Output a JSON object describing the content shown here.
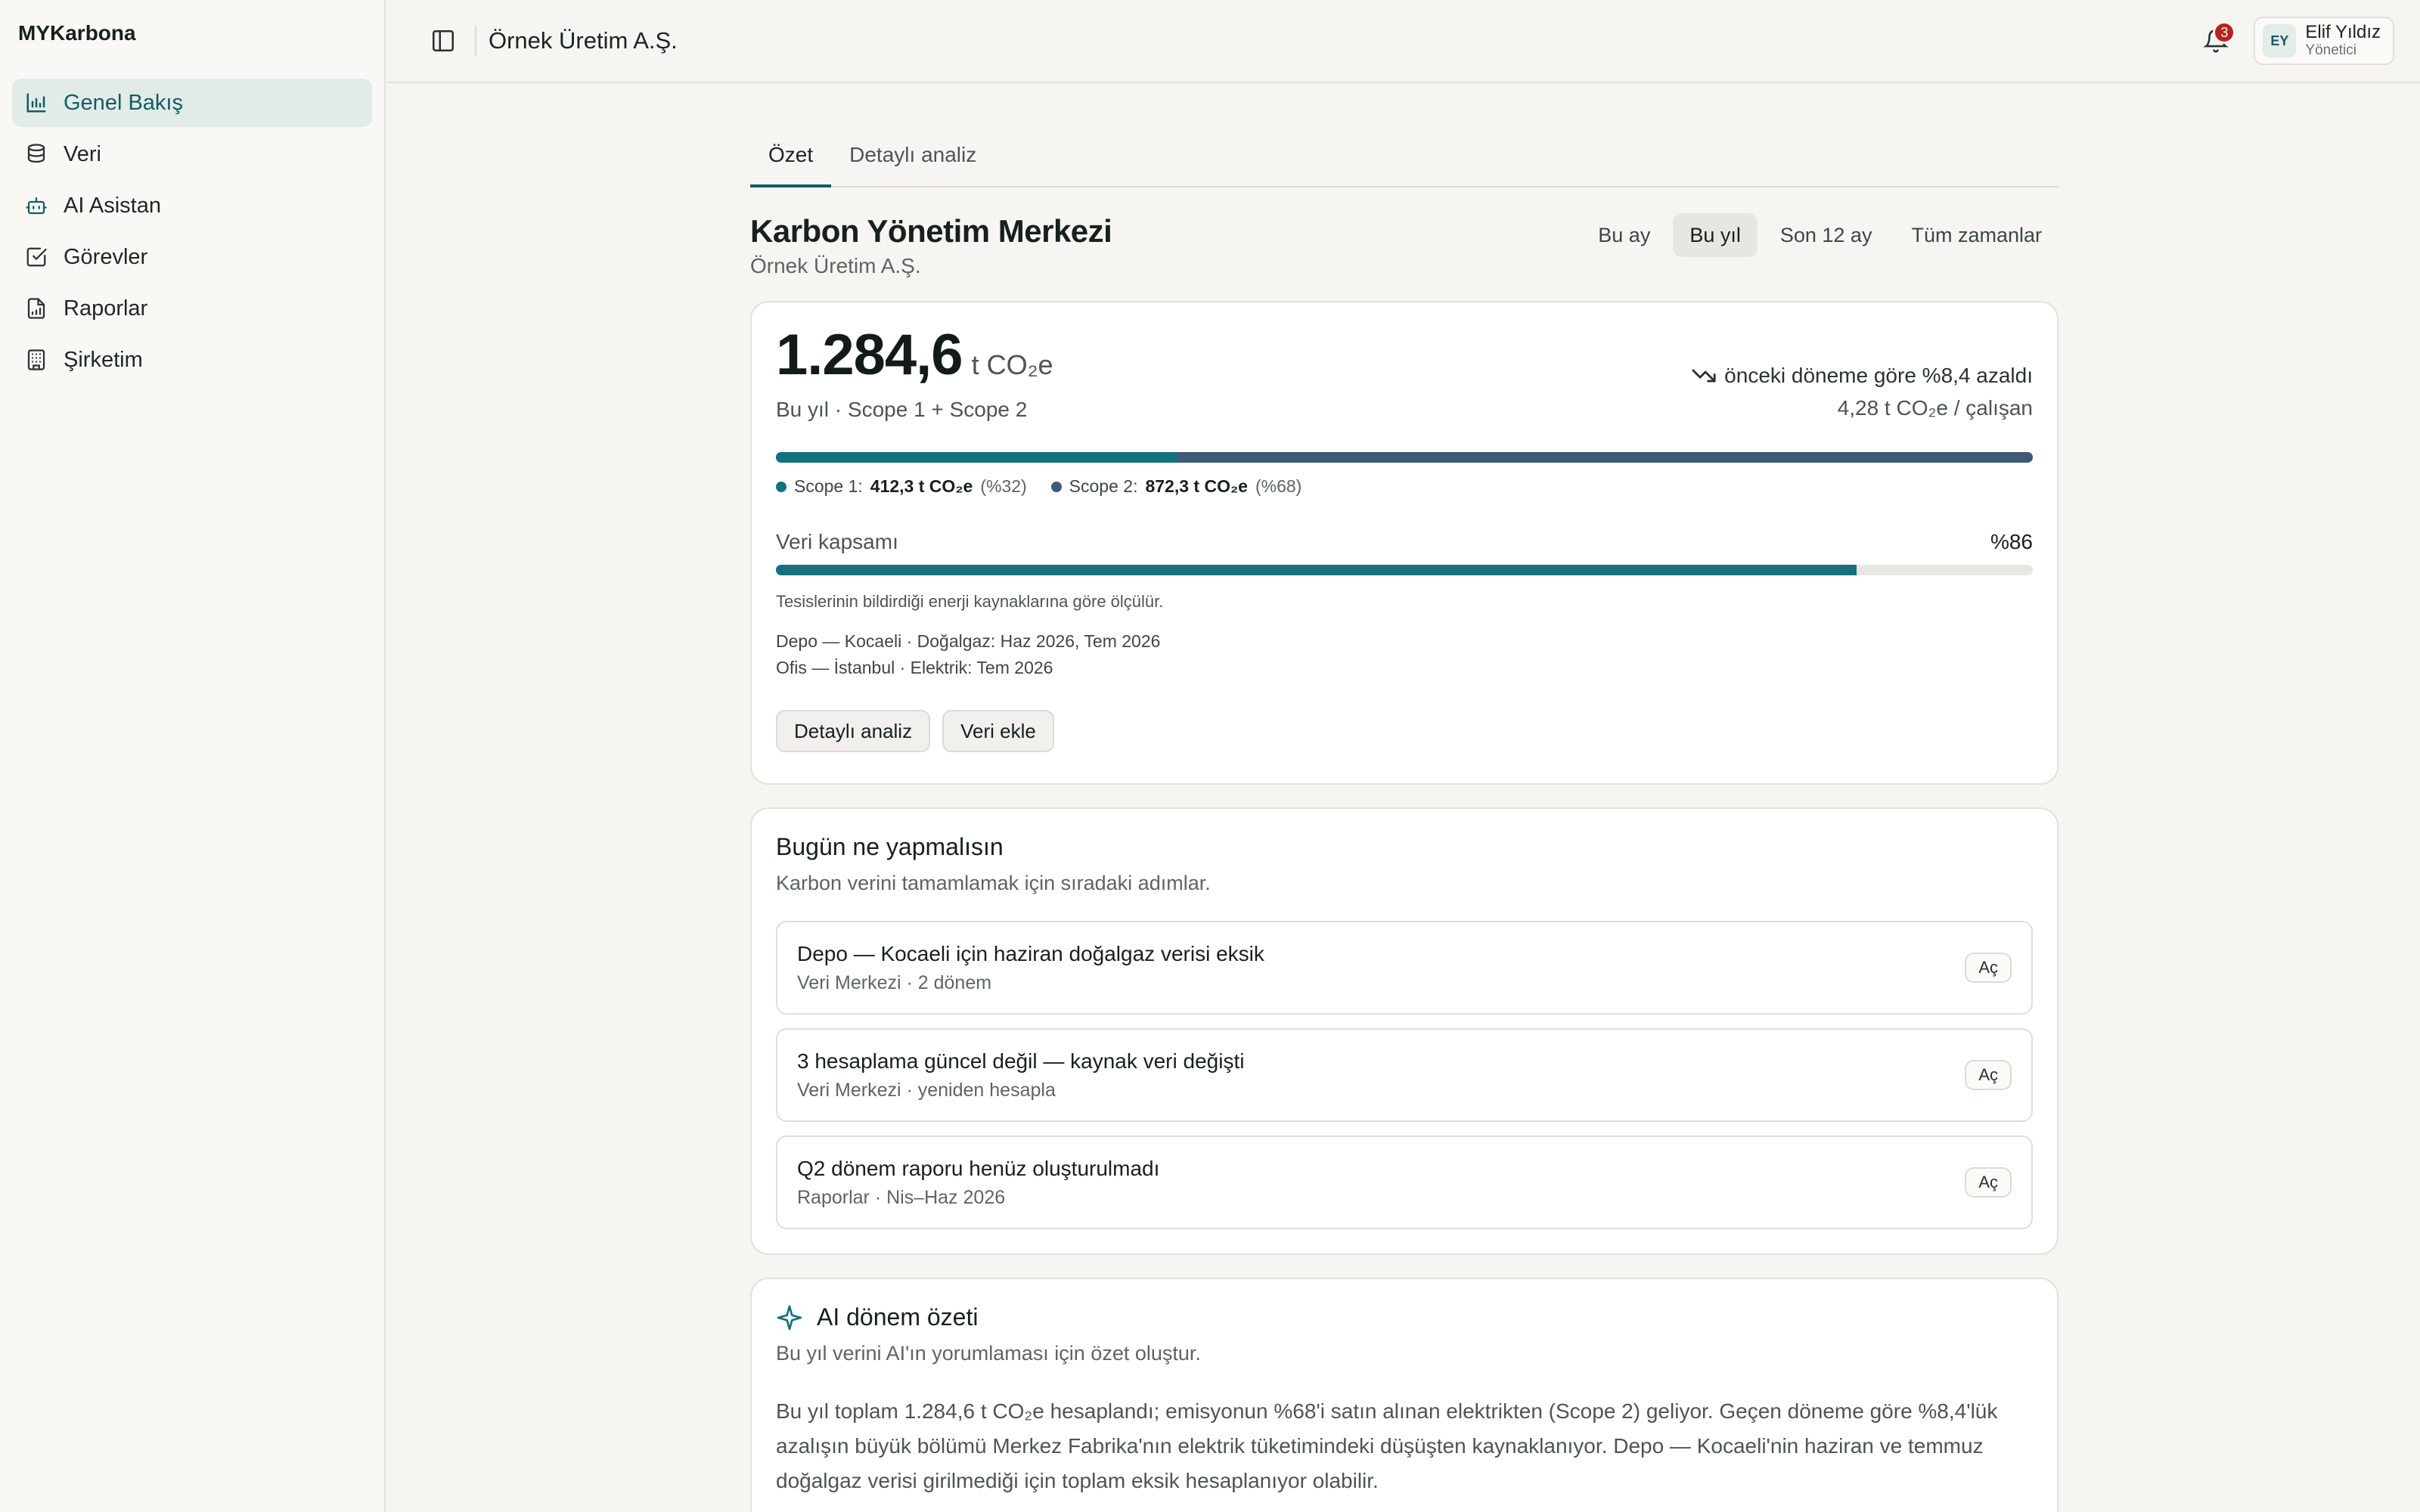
{
  "brand": "MYKarbona",
  "sidebar": {
    "items": [
      {
        "label": "Genel Bakış",
        "icon": "bar-chart-icon",
        "active": true
      },
      {
        "label": "Veri",
        "icon": "database-icon"
      },
      {
        "label": "AI Asistan",
        "icon": "bot-icon"
      },
      {
        "label": "Görevler",
        "icon": "checkbox-icon"
      },
      {
        "label": "Raporlar",
        "icon": "report-icon"
      },
      {
        "label": "Şirketim",
        "icon": "building-icon"
      }
    ]
  },
  "header": {
    "company": "Örnek Üretim A.Ş.",
    "notifications": "3",
    "user": {
      "initials": "EY",
      "name": "Elif Yıldız",
      "role": "Yönetici"
    }
  },
  "tabs": [
    {
      "label": "Özet",
      "active": true
    },
    {
      "label": "Detaylı analiz"
    }
  ],
  "page": {
    "title": "Karbon Yönetim Merkezi",
    "subtitle": "Örnek Üretim A.Ş.",
    "periods": [
      {
        "label": "Bu ay"
      },
      {
        "label": "Bu yıl",
        "active": true
      },
      {
        "label": "Son 12 ay"
      },
      {
        "label": "Tüm zamanlar"
      }
    ]
  },
  "summary": {
    "total": "1.284,6",
    "unit": "t CO₂e",
    "scope_note": "Bu yıl · Scope 1 + Scope 2",
    "trend_text": "önceki döneme göre %8,4 azaldı",
    "intensity": "4,28 t CO₂e / çalışan",
    "scope1": {
      "label": "Scope 1:",
      "value": "412,3 t CO₂e",
      "pct": "(%32)",
      "share": 0.32,
      "color": "#137180"
    },
    "scope2": {
      "label": "Scope 2:",
      "value": "872,3 t CO₂e",
      "pct": "(%68)",
      "share": 0.68,
      "color": "#3e5a74"
    },
    "coverage": {
      "label": "Veri kapsamı",
      "pct_text": "%86",
      "value": 0.86,
      "note": "Tesislerinin bildirdiği enerji kaynaklarına göre ölçülür.",
      "missing": [
        "Depo — Kocaeli · Doğalgaz: Haz 2026, Tem 2026",
        "Ofis — İstanbul · Elektrik: Tem 2026"
      ]
    },
    "buttons": {
      "analysis": "Detaylı analiz",
      "add_data": "Veri ekle"
    }
  },
  "todo": {
    "title": "Bugün ne yapmalısın",
    "subtitle": "Karbon verini tamamlamak için sıradaki adımlar.",
    "items": [
      {
        "title": "Depo — Kocaeli için haziran doğalgaz verisi eksik",
        "meta": "Veri Merkezi · 2 dönem",
        "action": "Aç"
      },
      {
        "title": "3 hesaplama güncel değil — kaynak veri değişti",
        "meta": "Veri Merkezi · yeniden hesapla",
        "action": "Aç"
      },
      {
        "title": "Q2 dönem raporu henüz oluşturulmadı",
        "meta": "Raporlar · Nis–Haz 2026",
        "action": "Aç"
      }
    ]
  },
  "ai": {
    "title": "AI dönem özeti",
    "subtitle": "Bu yıl verini AI'ın yorumlaması için özet oluştur.",
    "body": "Bu yıl toplam 1.284,6 t CO₂e hesaplandı; emisyonun %68'i satın alınan elektrikten (Scope 2) geliyor. Geçen döneme göre %8,4'lük azalışın büyük bölümü Merkez Fabrika'nın elektrik tüketimindeki düşüşten kaynaklanıyor. Depo — Kocaeli'nin haziran ve temmuz doğalgaz verisi girilmediği için toplam eksik hesaplanıyor olabilir."
  }
}
